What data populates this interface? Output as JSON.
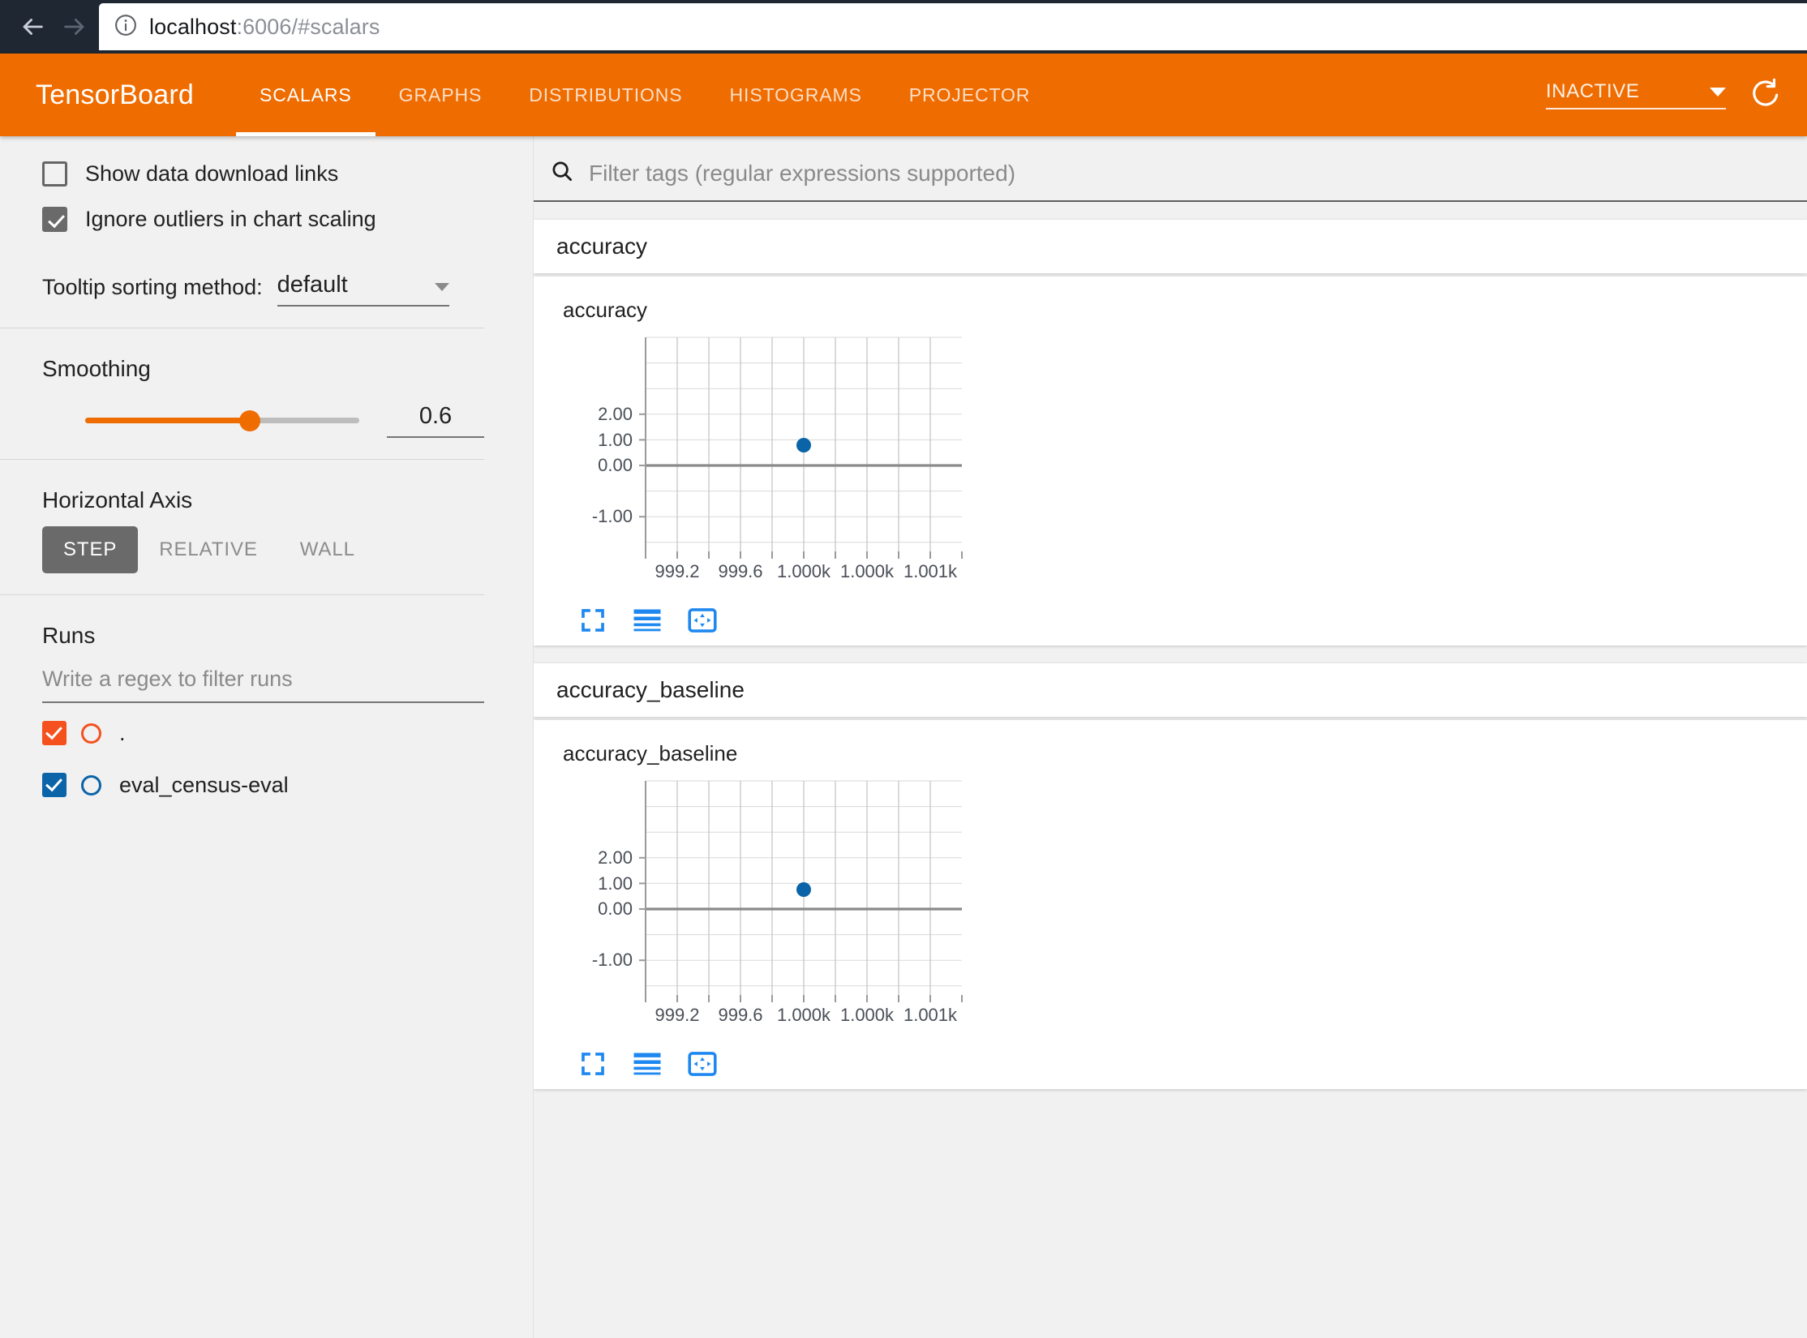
{
  "browser": {
    "back_icon": "arrow-left-icon",
    "forward_icon": "arrow-right-icon",
    "reload_icon": "reload-icon",
    "info_icon": "info-circle-icon",
    "url_host": "localhost",
    "url_rest": ":6006/#scalars"
  },
  "header": {
    "brand": "TensorBoard",
    "tabs": [
      {
        "label": "SCALARS",
        "active": true
      },
      {
        "label": "GRAPHS",
        "active": false
      },
      {
        "label": "DISTRIBUTIONS",
        "active": false
      },
      {
        "label": "HISTOGRAMS",
        "active": false
      },
      {
        "label": "PROJECTOR",
        "active": false
      }
    ],
    "status_select": "INACTIVE",
    "status_caret_icon": "chevron-down-icon",
    "refresh_icon": "refresh-icon"
  },
  "sidebar": {
    "show_download_links": {
      "label": "Show data download links",
      "checked": false
    },
    "ignore_outliers": {
      "label": "Ignore outliers in chart scaling",
      "checked": true
    },
    "tooltip_sorting": {
      "label": "Tooltip sorting method:",
      "value": "default",
      "caret_icon": "chevron-down-icon"
    },
    "smoothing": {
      "title": "Smoothing",
      "value": "0.6",
      "fill_percent": 60
    },
    "horizontal_axis": {
      "title": "Horizontal Axis",
      "options": [
        {
          "label": "STEP",
          "active": true
        },
        {
          "label": "RELATIVE",
          "active": false
        },
        {
          "label": "WALL",
          "active": false
        }
      ]
    },
    "runs": {
      "title": "Runs",
      "filter_placeholder": "Write a regex to filter runs",
      "items": [
        {
          "label": ".",
          "color": "#f4511e",
          "checked": true
        },
        {
          "label": "eval_census-eval",
          "color": "#0b64a8",
          "checked": true
        }
      ]
    }
  },
  "main": {
    "filter": {
      "search_icon": "search-icon",
      "placeholder": "Filter tags (regular expressions supported)"
    },
    "cards": [
      {
        "header": "accuracy",
        "chart_title": "accuracy",
        "toolbar": [
          {
            "icon": "fullscreen-expand-icon"
          },
          {
            "icon": "data-series-lines-icon"
          },
          {
            "icon": "pan-reset-icon"
          }
        ]
      },
      {
        "header": "accuracy_baseline",
        "chart_title": "accuracy_baseline",
        "toolbar": [
          {
            "icon": "fullscreen-expand-icon"
          },
          {
            "icon": "data-series-lines-icon"
          },
          {
            "icon": "pan-reset-icon"
          }
        ]
      }
    ]
  },
  "chart_data": [
    {
      "type": "scatter",
      "title": "accuracy",
      "xlabel": "",
      "ylabel": "",
      "x_tick_labels": [
        "999.2",
        "999.6",
        "1.000k",
        "1.000k",
        "1.001k"
      ],
      "x_tick_values": [
        999.2,
        999.6,
        999.9,
        1000.3,
        1000.7
      ],
      "y_tick_labels": [
        "2.00",
        "1.00",
        "0.00",
        "-1.00"
      ],
      "y_tick_values": [
        2.0,
        1.0,
        0.0,
        -1.0
      ],
      "xlim": [
        999.0,
        1000.9
      ],
      "ylim": [
        -1.45,
        2.72
      ],
      "grid": true,
      "y_minor_step": 0.5,
      "zero_line": 0.0,
      "legend": false,
      "series": [
        {
          "name": "eval_census-eval",
          "color": "#0b64a8",
          "x": [
            1000.0
          ],
          "y": [
            0.78
          ]
        }
      ]
    },
    {
      "type": "scatter",
      "title": "accuracy_baseline",
      "xlabel": "",
      "ylabel": "",
      "x_tick_labels": [
        "999.2",
        "999.6",
        "1.000k",
        "1.000k",
        "1.001k"
      ],
      "x_tick_values": [
        999.2,
        999.6,
        999.9,
        1000.3,
        1000.7
      ],
      "y_tick_labels": [
        "2.00",
        "1.00",
        "0.00",
        "-1.00"
      ],
      "y_tick_values": [
        2.0,
        1.0,
        0.0,
        -1.0
      ],
      "xlim": [
        999.0,
        1000.9
      ],
      "ylim": [
        -1.45,
        2.72
      ],
      "grid": true,
      "y_minor_step": 0.5,
      "zero_line": 0.0,
      "legend": false,
      "series": [
        {
          "name": "eval_census-eval",
          "color": "#0b64a8",
          "x": [
            1000.0
          ],
          "y": [
            0.76
          ]
        }
      ]
    }
  ]
}
